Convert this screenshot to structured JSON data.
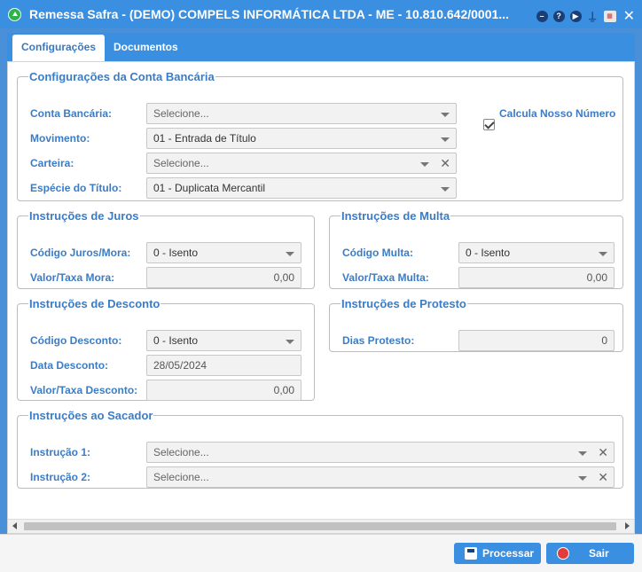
{
  "window": {
    "title": "Remessa Safra - (DEMO) COMPELS INFORMÁTICA LTDA - ME - 10.810.642/0001...",
    "icons": [
      "minimize-icon",
      "help-icon",
      "play-icon",
      "stamp-icon",
      "calendar-icon",
      "close-icon"
    ]
  },
  "tabs": [
    {
      "label": "Configurações",
      "active": true
    },
    {
      "label": "Documentos",
      "active": false
    }
  ],
  "conta": {
    "legend": "Configurações da Conta Bancária",
    "conta_label": "Conta Bancária:",
    "conta_value": "Selecione...",
    "movimento_label": "Movimento:",
    "movimento_value": "01 - Entrada de Título",
    "carteira_label": "Carteira:",
    "carteira_value": "Selecione...",
    "especie_label": "Espécie do Título:",
    "especie_value": "01 - Duplicata Mercantil",
    "calcula_label": "Calcula Nosso Número",
    "calcula_checked": true
  },
  "juros": {
    "legend": "Instruções de Juros",
    "codigo_label": "Código Juros/Mora:",
    "codigo_value": "0 - Isento",
    "valor_label": "Valor/Taxa Mora:",
    "valor_value": "0,00"
  },
  "multa": {
    "legend": "Instruções de Multa",
    "codigo_label": "Código Multa:",
    "codigo_value": "0 - Isento",
    "valor_label": "Valor/Taxa Multa:",
    "valor_value": "0,00"
  },
  "desconto": {
    "legend": "Instruções de Desconto",
    "codigo_label": "Código Desconto:",
    "codigo_value": "0 - Isento",
    "data_label": "Data Desconto:",
    "data_value": "28/05/2024",
    "valor_label": "Valor/Taxa Desconto:",
    "valor_value": "0,00"
  },
  "protesto": {
    "legend": "Instruções de Protesto",
    "dias_label": "Dias Protesto:",
    "dias_value": "0"
  },
  "sacador": {
    "legend": "Instruções ao Sacador",
    "inst1_label": "Instrução 1:",
    "inst1_value": "Selecione...",
    "inst2_label": "Instrução 2:",
    "inst2_value": "Selecione..."
  },
  "footer": {
    "processar_label": "Processar",
    "sair_label": "Sair"
  },
  "colors": {
    "accent": "#3b8fe0",
    "label": "#3c7cc5"
  }
}
